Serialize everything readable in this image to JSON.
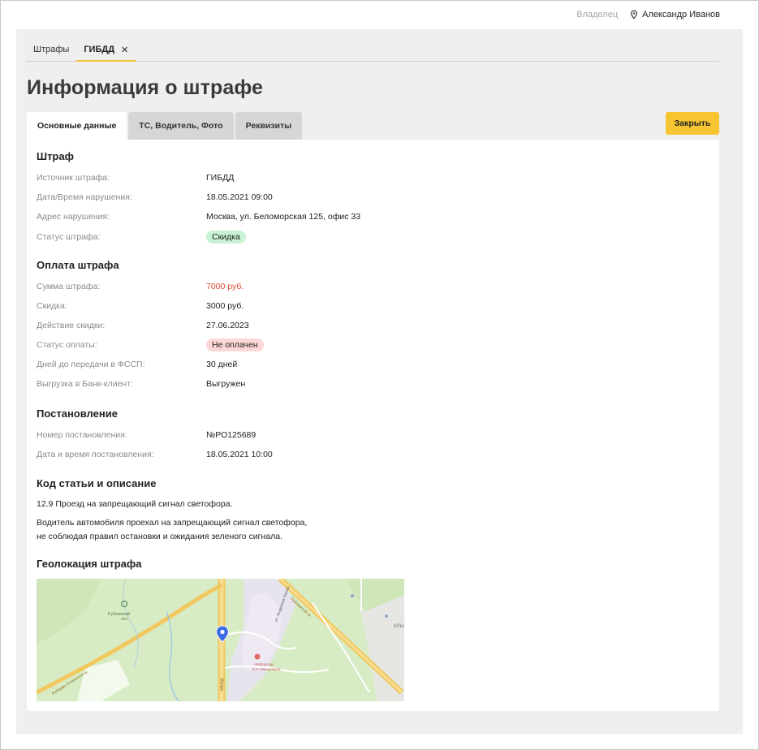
{
  "header": {
    "owner_label": "Владелец",
    "user_name": "Александр Иванов"
  },
  "top_tabs": [
    {
      "label": "Штрафы"
    },
    {
      "label": "ГИБДД",
      "close": "✕"
    }
  ],
  "page_title": "Информация о штрафе",
  "sub_tabs": [
    {
      "label": "Основные данные"
    },
    {
      "label": "ТС, Водитель, Фото"
    },
    {
      "label": "Реквизиты"
    }
  ],
  "close_button": "Закрыть",
  "sections": {
    "fine": {
      "title": "Штраф",
      "rows": [
        {
          "label": "Источник штрафа:",
          "value": "ГИБДД"
        },
        {
          "label": "Дата/Время нарушения:",
          "value": "18.05.2021 09:00"
        },
        {
          "label": "Адрес нарушения:",
          "value": "Москва, ул. Беломорская 125, офис 33"
        },
        {
          "label": "Статус штрафа:",
          "value": "Скидка"
        }
      ]
    },
    "payment": {
      "title": "Оплата штрафа",
      "rows": [
        {
          "label": "Сумма штрафа:",
          "value": "7000 руб."
        },
        {
          "label": "Скидка:",
          "value": "3000 руб."
        },
        {
          "label": "Действие скидки:",
          "value": "27.06.2023"
        },
        {
          "label": "Статус оплаты:",
          "value": "Не оплачен"
        },
        {
          "label": "Дней до передачи в ФССП:",
          "value": "30 дней"
        },
        {
          "label": "Выгрузка в Банк-клиент:",
          "value": "Выгружен"
        }
      ]
    },
    "resolution": {
      "title": "Постановление",
      "rows": [
        {
          "label": "Номер постановления:",
          "value": "№РО125689"
        },
        {
          "label": "Дата и время постановления:",
          "value": "18.05.2021 10:00"
        }
      ]
    },
    "article": {
      "title": "Код статьи и описание",
      "code_line": "12.9 Проезд на запрещающий сигнал светофора.",
      "desc_line1": "Водитель автомобиля проехал на запрещающий сигнал светофора,",
      "desc_line2": "не соблюдая правил остановки и ожидания зеленого сигнала."
    },
    "geo": {
      "title": "Геолокация штрафа"
    }
  },
  "map": {
    "labels": {
      "forest": "Рублевский",
      "forest2": "лес",
      "mkad": "МКАД",
      "rublev": "Рублевское ш.",
      "rublev_w": "Рублево-Успенское ш.",
      "hospital": "НМИЦН им.",
      "hospital2": "Е.Н. Мешалкина",
      "street": "ул. Академика Чазова",
      "kr": "КРЫ"
    }
  },
  "colors": {
    "accent": "#f6c531",
    "status_green": "#c8f2d3",
    "status_pink": "#fcd7d7",
    "sum_red": "#e0462a"
  }
}
